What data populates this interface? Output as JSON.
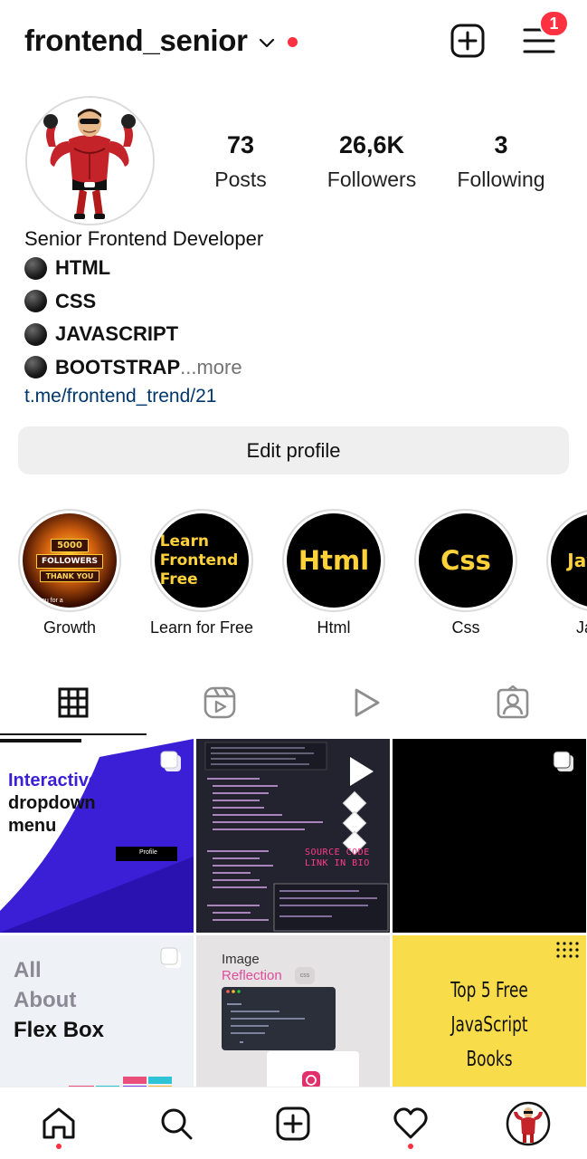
{
  "header": {
    "username": "frontend_senior",
    "notification_count": "1"
  },
  "profile": {
    "stats": [
      {
        "value": "73",
        "label": "Posts"
      },
      {
        "value": "26,6K",
        "label": "Followers"
      },
      {
        "value": "3",
        "label": "Following"
      }
    ],
    "bio": {
      "name": "Senior Frontend Developer",
      "lines": [
        "HTML",
        "CSS",
        "JAVASCRIPT",
        "BOOTSTRAP"
      ],
      "truncation": "...",
      "more": " more",
      "link": "t.me/frontend_trend/21"
    },
    "edit_button": "Edit profile"
  },
  "highlights": [
    {
      "label": "Growth",
      "cover_lines": [
        "5000",
        "FOLLOWERS",
        "THANK YOU"
      ],
      "cover_footer": "k you for a"
    },
    {
      "label": "Learn for Free",
      "cover_lines": [
        "Learn",
        "Frontend",
        "Free"
      ]
    },
    {
      "label": "Html",
      "cover_text": "Html"
    },
    {
      "label": "Css",
      "cover_text": "Css"
    },
    {
      "label": "Java",
      "cover_text": "Java"
    }
  ],
  "tabs": [
    {
      "icon": "grid-icon",
      "active": true
    },
    {
      "icon": "reels-icon",
      "active": false
    },
    {
      "icon": "play-icon",
      "active": false
    },
    {
      "icon": "tagged-icon",
      "active": false
    }
  ],
  "posts": [
    {
      "title_lines": [
        "Interactive",
        "dropdown",
        "menu"
      ],
      "button_text": "Profile",
      "multi": true
    },
    {
      "overlay_lines": [
        "SOURCE CODE",
        "LINK IN BIO"
      ],
      "multi": false
    },
    {
      "multi": true
    },
    {
      "title_lines": [
        "All",
        "About",
        "Flex Box"
      ],
      "multi": true
    },
    {
      "title": "Image",
      "subtitle": "Reflection",
      "tag": "css",
      "multi": false
    },
    {
      "title_lines": [
        "Top 5 Free",
        "JavaScript",
        "Books"
      ],
      "multi": false
    }
  ],
  "bottom_nav": [
    "home-icon",
    "search-icon",
    "create-icon",
    "heart-icon",
    "profile-avatar"
  ],
  "colors": {
    "accent_red": "#ff3040",
    "link_blue": "#00376b",
    "highlight_yellow": "#ffd23a",
    "post_purple": "#3b1fd6",
    "post_yellow": "#f8dc4a"
  }
}
